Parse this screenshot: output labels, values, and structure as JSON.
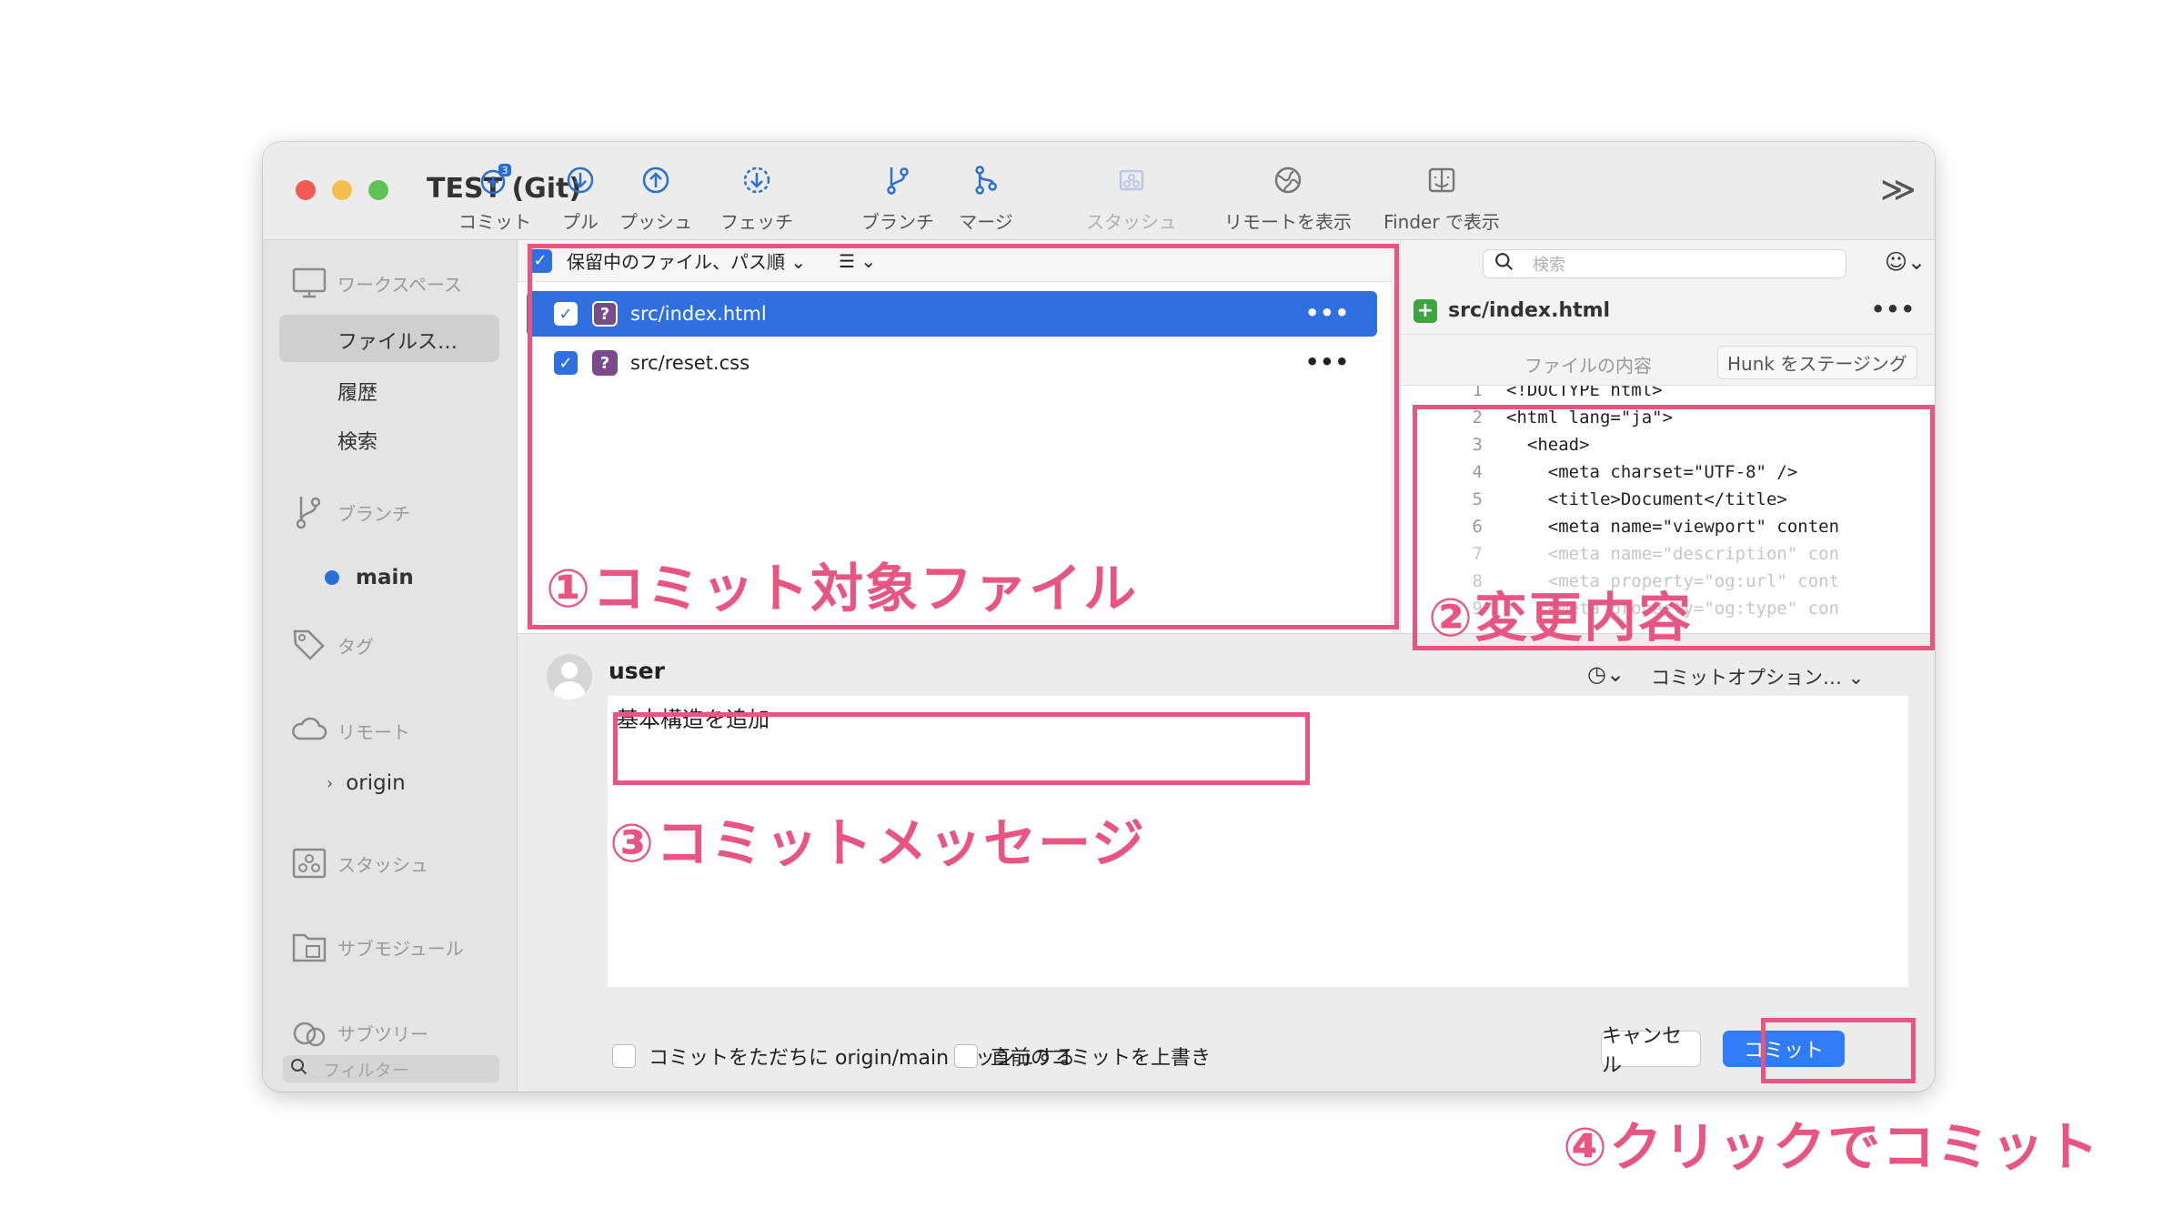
{
  "window": {
    "title": "TEST (Git)"
  },
  "toolbar": {
    "commit": {
      "label": "コミット",
      "badge": "3"
    },
    "pull": {
      "label": "プル"
    },
    "push": {
      "label": "プッシュ"
    },
    "fetch": {
      "label": "フェッチ"
    },
    "branch": {
      "label": "ブランチ"
    },
    "merge": {
      "label": "マージ"
    },
    "stash": {
      "label": "スタッシュ"
    },
    "remote": {
      "label": "リモートを表示"
    },
    "finder": {
      "label": "Finder で表示"
    },
    "more_glyph": "≫"
  },
  "sidebar": {
    "workspace": "ワークスペース",
    "workspace_items": [
      "ファイルス…",
      "履歴",
      "検索"
    ],
    "branches": "ブランチ",
    "branch_main": "main",
    "tags": "タグ",
    "remotes": "リモート",
    "remote_origin": "origin",
    "stashes": "スタッシュ",
    "submodules": "サブモジュール",
    "subtrees": "サブツリー",
    "filter_placeholder": "フィルター"
  },
  "files": {
    "header_label": "保留中のファイル、パス順",
    "rows": [
      {
        "name": "src/index.html",
        "selected": true
      },
      {
        "name": "src/reset.css",
        "selected": false
      }
    ]
  },
  "diff": {
    "search_placeholder": "検索",
    "file_name": "src/index.html",
    "file_contents_label": "ファイルの内容",
    "stage_hunk_label": "Hunk をステージング",
    "lines": [
      {
        "n": "1",
        "t": "<!DOCTYPE html>"
      },
      {
        "n": "2",
        "t": "<html lang=\"ja\">"
      },
      {
        "n": "3",
        "t": "  <head>"
      },
      {
        "n": "4",
        "t": "    <meta charset=\"UTF-8\" />"
      },
      {
        "n": "5",
        "t": "    <title>Document</title>"
      },
      {
        "n": "6",
        "t": "    <meta name=\"viewport\" conten"
      },
      {
        "n": "7",
        "t": "    <meta name=\"description\" con"
      },
      {
        "n": "8",
        "t": "    <meta property=\"og:url\" cont"
      },
      {
        "n": "9",
        "t": "    <meta property=\"og:type\" con"
      }
    ]
  },
  "commit": {
    "user": "user",
    "options_label": "コミットオプション…",
    "message": "基本構造を追加",
    "push_immediately": "コミットをただちに origin/main プッシュする",
    "amend": "直前のコミットを上書き",
    "cancel": "キャンセル",
    "commit": "コミット"
  },
  "annotations": {
    "a1": "①コミット対象ファイル",
    "a2": "②変更内容",
    "a3": "③コミットメッセージ",
    "a4": "④クリックでコミット"
  },
  "colors": {
    "highlight": "#e85580",
    "accent": "#2f6fe0",
    "commit_button": "#2f7cf6"
  }
}
